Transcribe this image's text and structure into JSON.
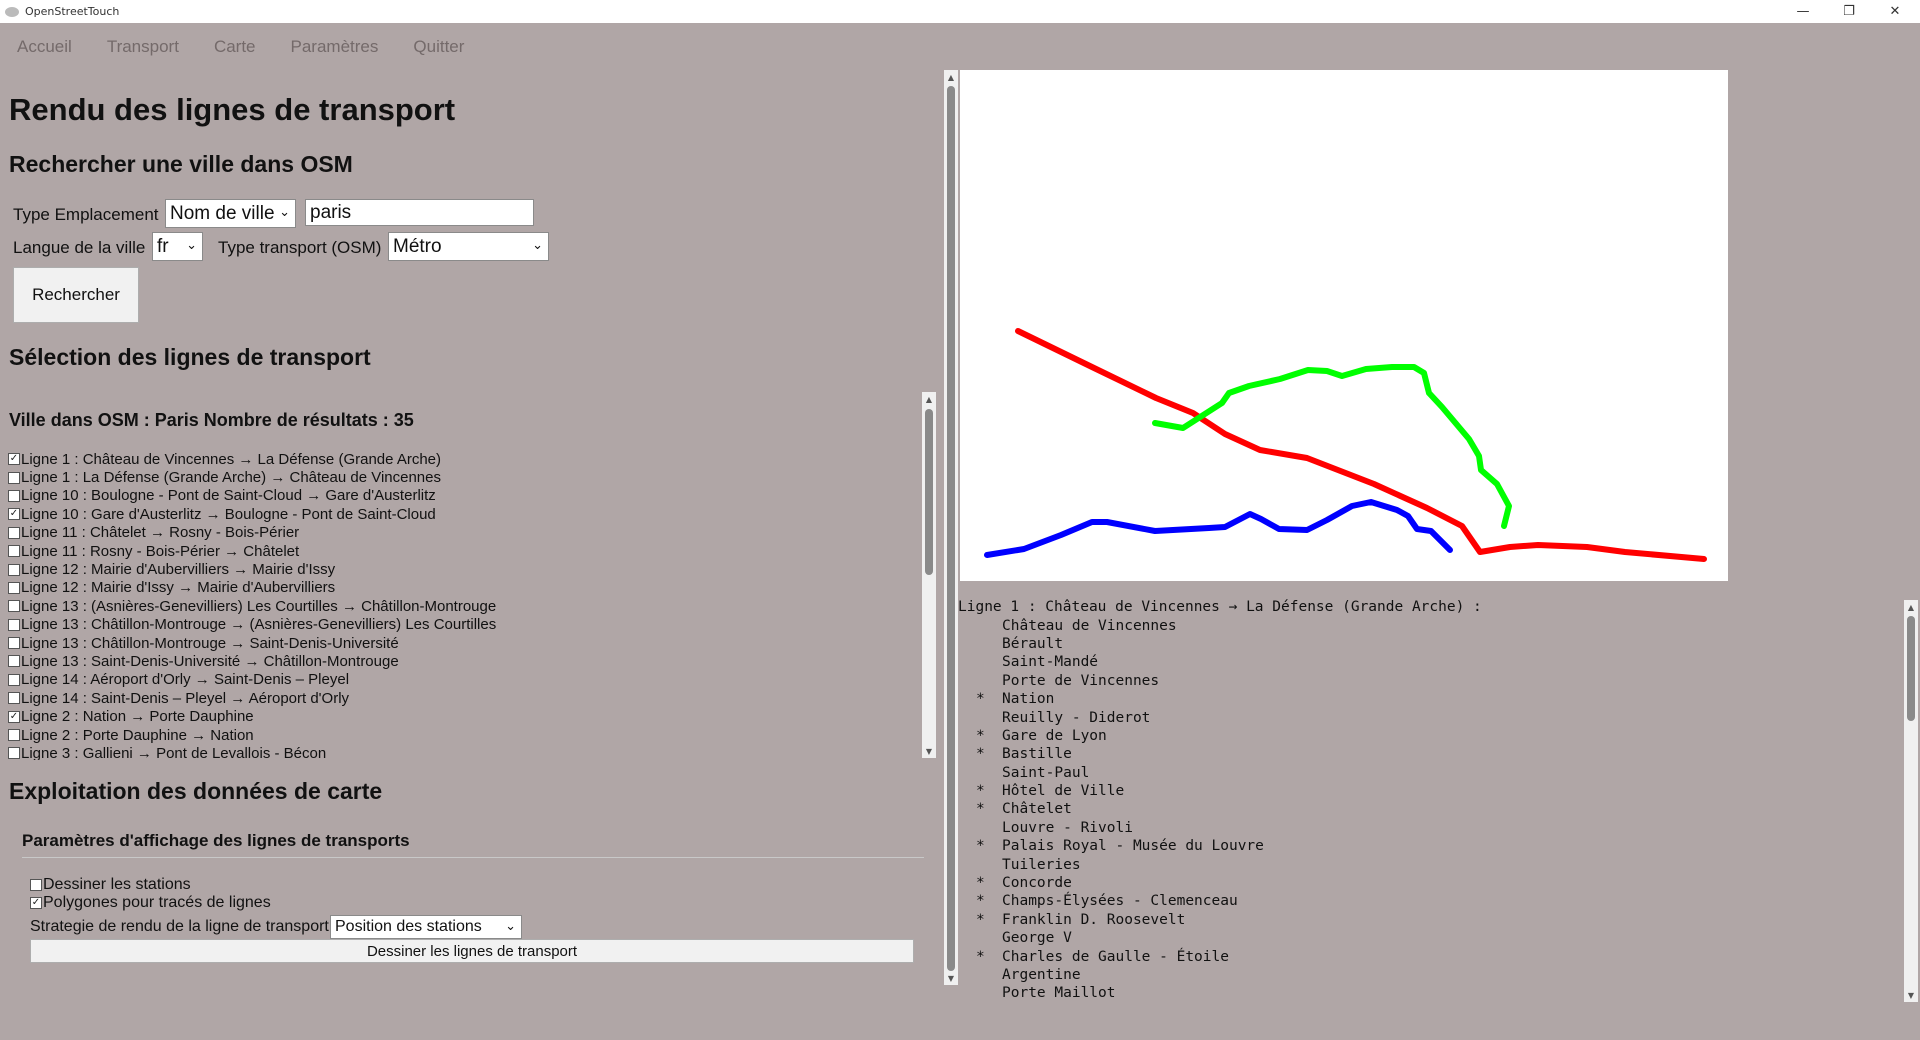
{
  "window": {
    "title": "OpenStreetTouch",
    "minimize_glyph": "—",
    "maximize_glyph": "❐",
    "close_glyph": "✕"
  },
  "menu": {
    "items": [
      "Accueil",
      "Transport",
      "Carte",
      "Paramètres",
      "Quitter"
    ]
  },
  "page_title": "Rendu des lignes de transport",
  "search": {
    "heading": "Rechercher une ville dans OSM",
    "location_type_label": "Type Emplacement",
    "location_type_value": "Nom de ville",
    "city_input_value": "paris",
    "language_label": "Langue de la ville",
    "language_value": "fr",
    "transport_type_label": "Type transport (OSM)",
    "transport_type_value": "Métro",
    "search_button": "Rechercher"
  },
  "selection": {
    "heading": "Sélection des lignes de transport",
    "summary": "Ville dans OSM : Paris Nombre de résultats : 35",
    "lines": [
      {
        "label": "Ligne 1 : Château de Vincennes → La Défense (Grande Arche)",
        "checked": true
      },
      {
        "label": "Ligne 1 : La Défense (Grande Arche) → Château de Vincennes",
        "checked": false
      },
      {
        "label": "Ligne 10 : Boulogne - Pont de Saint-Cloud → Gare d'Austerlitz",
        "checked": false
      },
      {
        "label": "Ligne 10 : Gare d'Austerlitz → Boulogne - Pont de Saint-Cloud",
        "checked": true
      },
      {
        "label": "Ligne 11 : Châtelet → Rosny - Bois-Périer",
        "checked": false
      },
      {
        "label": "Ligne 11 : Rosny - Bois-Périer → Châtelet",
        "checked": false
      },
      {
        "label": "Ligne 12 : Mairie d'Aubervilliers → Mairie d'Issy",
        "checked": false
      },
      {
        "label": "Ligne 12 : Mairie d'Issy → Mairie d'Aubervilliers",
        "checked": false
      },
      {
        "label": "Ligne 13 : (Asnières-Genevilliers) Les Courtilles → Châtillon-Montrouge",
        "checked": false
      },
      {
        "label": "Ligne 13 : Châtillon-Montrouge → (Asnières-Genevilliers) Les Courtilles",
        "checked": false
      },
      {
        "label": "Ligne 13 : Châtillon-Montrouge → Saint-Denis-Université",
        "checked": false
      },
      {
        "label": "Ligne 13 : Saint-Denis-Université → Châtillon-Montrouge",
        "checked": false
      },
      {
        "label": "Ligne 14 : Aéroport d'Orly → Saint-Denis – Pleyel",
        "checked": false
      },
      {
        "label": "Ligne 14 : Saint-Denis – Pleyel → Aéroport d'Orly",
        "checked": false
      },
      {
        "label": "Ligne 2 : Nation → Porte Dauphine",
        "checked": true
      },
      {
        "label": "Ligne 2 : Porte Dauphine → Nation",
        "checked": false
      },
      {
        "label": "Ligne 3 : Gallieni → Pont de Levallois - Bécon",
        "checked": false
      }
    ]
  },
  "exploitation": {
    "heading": "Exploitation des données de carte",
    "display_params_heading": "Paramètres d'affichage des lignes de transports",
    "draw_stations_label": "Dessiner les stations",
    "draw_stations_checked": false,
    "polygons_label": "Polygones pour tracés de lignes",
    "polygons_checked": true,
    "strategy_label": "Strategie de rendu de la ligne de transport",
    "strategy_value": "Position des stations",
    "draw_button": "Dessiner les lignes de transport"
  },
  "map": {
    "line_colors": {
      "ligne1": "#ff0000",
      "ligne10": "#0000ff",
      "ligne2": "#00ff00"
    }
  },
  "stations": {
    "header": "Ligne 1 : Château de Vincennes → La Défense (Grande Arche) :",
    "items": [
      {
        "marker": " ",
        "name": "Château de Vincennes"
      },
      {
        "marker": " ",
        "name": "Bérault"
      },
      {
        "marker": " ",
        "name": "Saint-Mandé"
      },
      {
        "marker": " ",
        "name": "Porte de Vincennes"
      },
      {
        "marker": "*",
        "name": "Nation"
      },
      {
        "marker": " ",
        "name": "Reuilly - Diderot"
      },
      {
        "marker": "*",
        "name": "Gare de Lyon"
      },
      {
        "marker": "*",
        "name": "Bastille"
      },
      {
        "marker": " ",
        "name": "Saint-Paul"
      },
      {
        "marker": "*",
        "name": "Hôtel de Ville"
      },
      {
        "marker": "*",
        "name": "Châtelet"
      },
      {
        "marker": " ",
        "name": "Louvre - Rivoli"
      },
      {
        "marker": "*",
        "name": "Palais Royal - Musée du Louvre"
      },
      {
        "marker": " ",
        "name": "Tuileries"
      },
      {
        "marker": "*",
        "name": "Concorde"
      },
      {
        "marker": "*",
        "name": "Champs-Élysées - Clemenceau"
      },
      {
        "marker": "*",
        "name": "Franklin D. Roosevelt"
      },
      {
        "marker": " ",
        "name": "George V"
      },
      {
        "marker": "*",
        "name": "Charles de Gaulle - Étoile"
      },
      {
        "marker": " ",
        "name": "Argentine"
      },
      {
        "marker": " ",
        "name": "Porte Maillot"
      }
    ]
  }
}
